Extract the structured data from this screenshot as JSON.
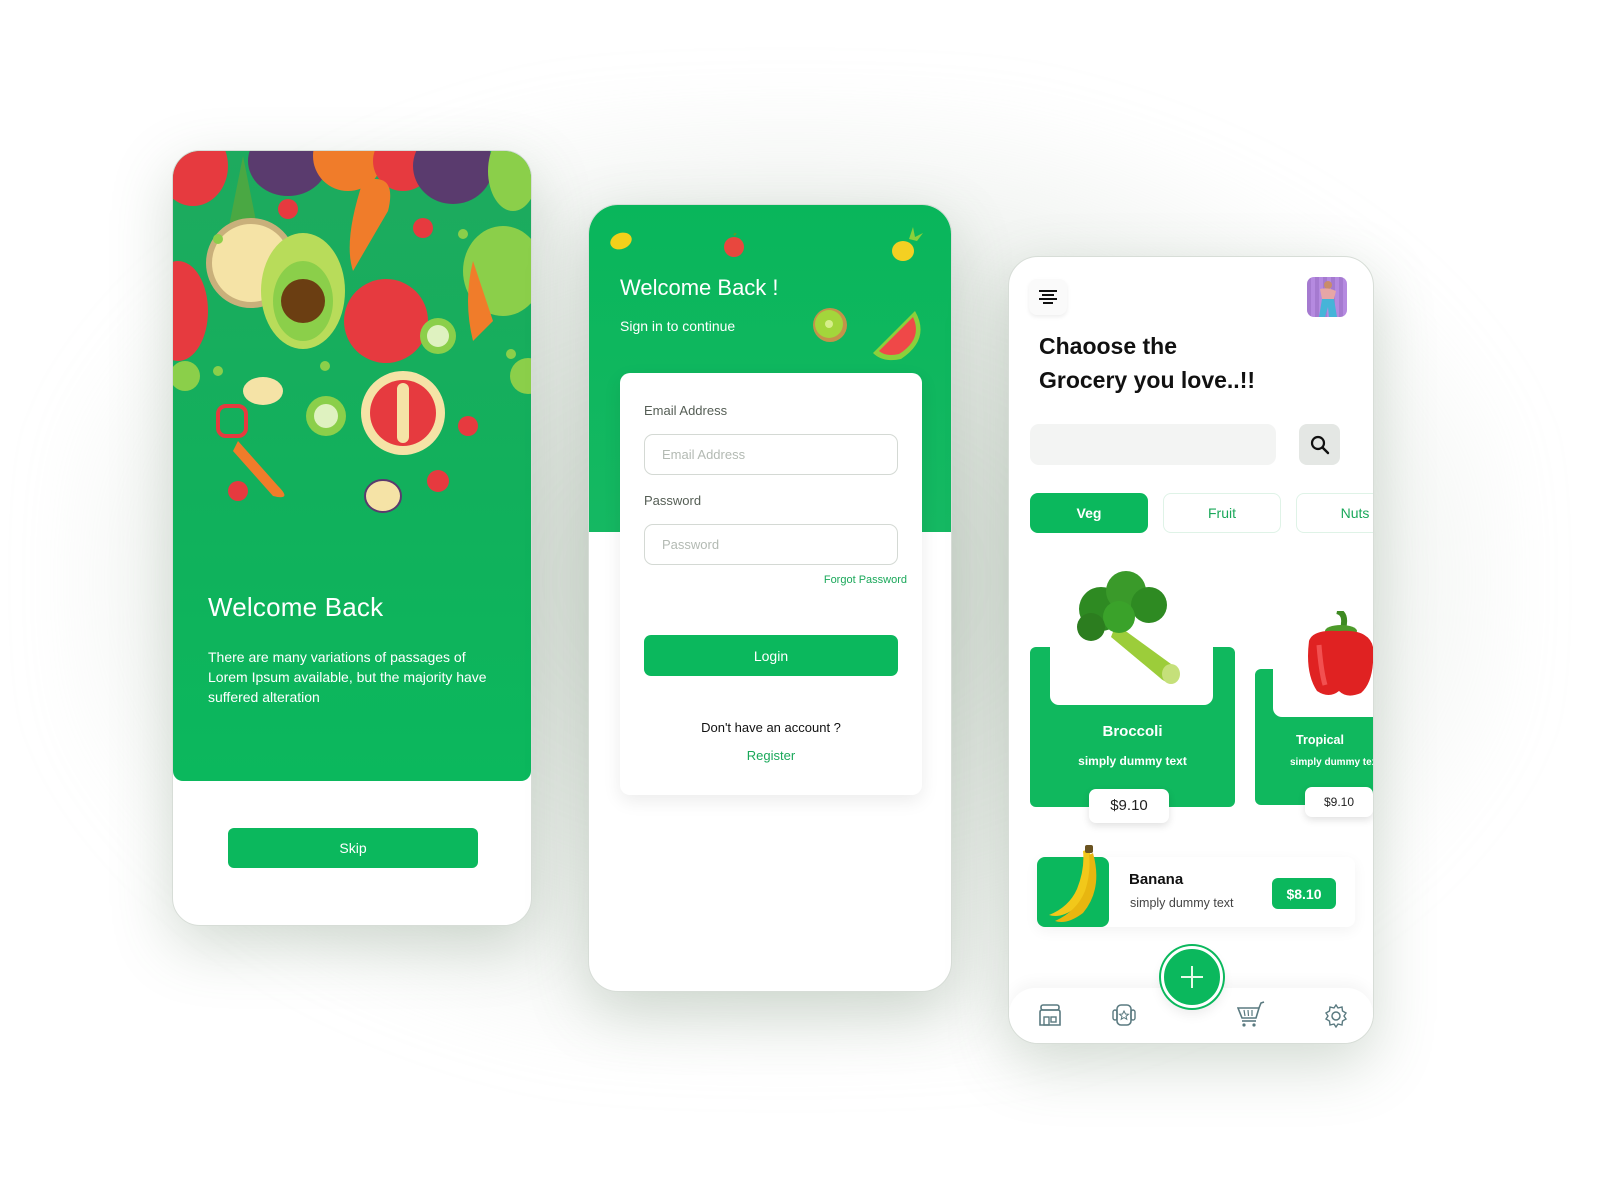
{
  "theme": {
    "primary": "#0bb85d",
    "primary_text_on": "#ffffff",
    "link": "#1aa85a"
  },
  "onboarding": {
    "title": "Welcome Back",
    "description": "There are many variations of passages of Lorem Ipsum available, but the majority have suffered alteration",
    "skip_label": "Skip",
    "illustration": "vegetables-pattern"
  },
  "login": {
    "title": "Welcome Back !",
    "subtitle": "Sign in to continue",
    "decorations": [
      "lemon-icon",
      "apple-icon",
      "pineapple-icon",
      "kiwi-icon",
      "watermelon-icon"
    ],
    "email": {
      "label": "Email Address",
      "placeholder": "Email Address",
      "value": ""
    },
    "password": {
      "label": "Password",
      "placeholder": "Password",
      "value": ""
    },
    "forgot_label": "Forgot Password",
    "login_label": "Login",
    "no_account_text": "Don't have an account ?",
    "register_label": "Register"
  },
  "home": {
    "heading_line1": "Chaoose the",
    "heading_line2": "Grocery you love..!!",
    "search": {
      "placeholder": "",
      "value": ""
    },
    "categories": [
      {
        "label": "Veg",
        "active": true
      },
      {
        "label": "Fruit",
        "active": false
      },
      {
        "label": "Nuts",
        "active": false
      }
    ],
    "featured": [
      {
        "name": "Broccoli",
        "subtitle": "simply dummy text",
        "price": "$9.10",
        "image": "broccoli"
      },
      {
        "name": "Tropical",
        "subtitle": "simply dummy text",
        "price": "$9.10",
        "image": "red-bell-pepper"
      }
    ],
    "list": [
      {
        "name": "Banana",
        "subtitle": "simply dummy text",
        "price": "$8.10",
        "image": "banana"
      }
    ],
    "bottom_nav": [
      "store-icon",
      "wallet-icon",
      "add-icon",
      "cart-icon",
      "settings-icon"
    ]
  }
}
